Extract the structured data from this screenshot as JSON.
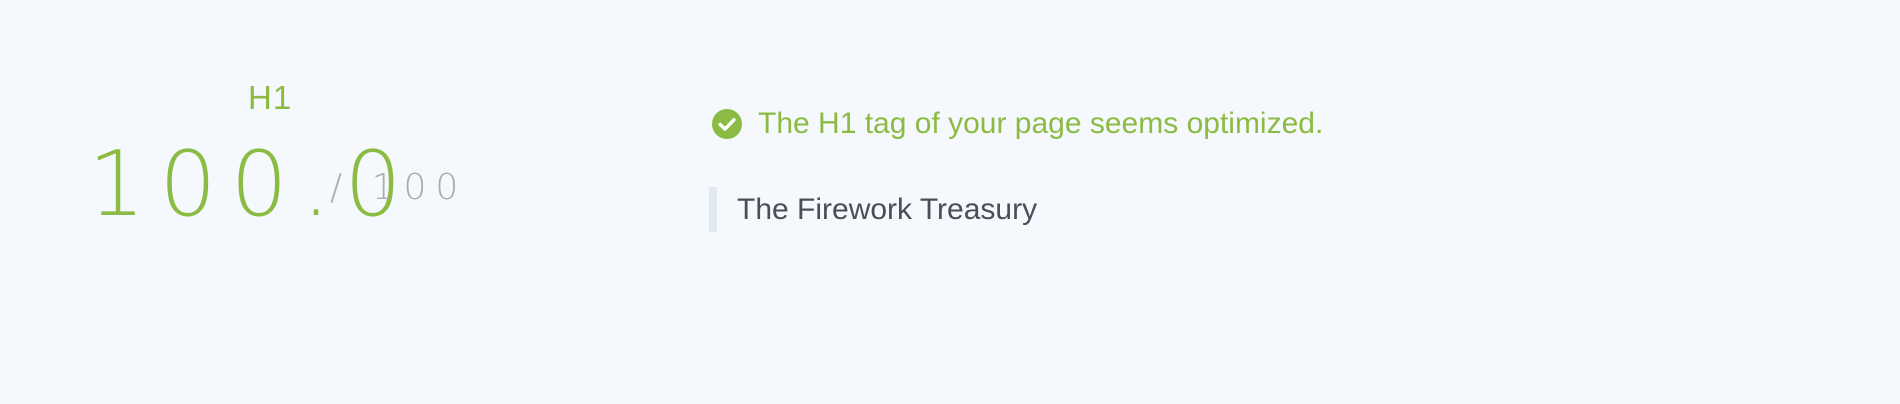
{
  "score": {
    "label": "H1",
    "value": "100.0",
    "max": "/ 100",
    "color": "#8bbb43"
  },
  "result": {
    "status_icon": "check-circle-icon",
    "status_text": "The H1 tag of your page seems optimized.",
    "h1_text": "The Firework Treasury"
  }
}
